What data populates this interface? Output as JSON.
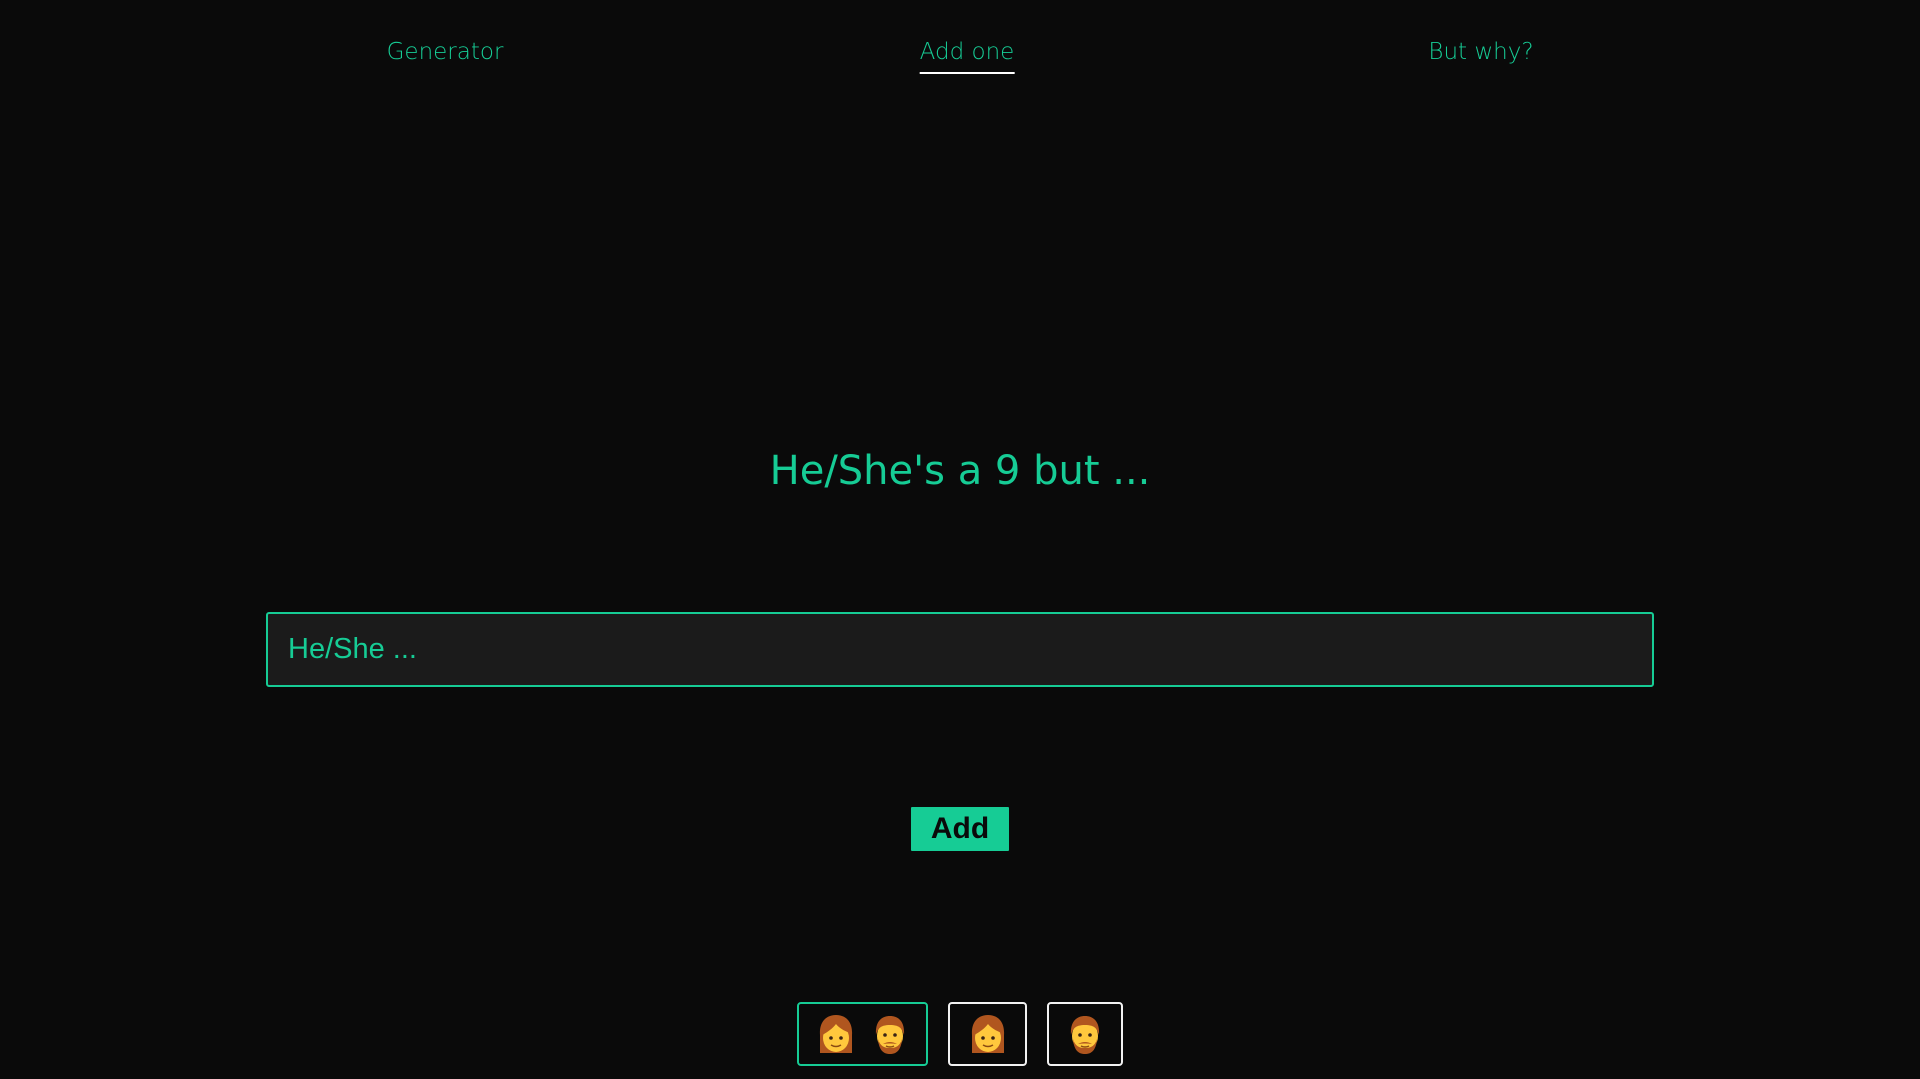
{
  "nav": {
    "items": [
      {
        "label": "Generator",
        "active": false
      },
      {
        "label": "Add one",
        "active": true
      },
      {
        "label": "But why?",
        "active": false
      }
    ]
  },
  "main": {
    "headline": "He/She's a 9 but ...",
    "input": {
      "placeholder": "He/She ...",
      "value": ""
    },
    "add_button_label": "Add"
  },
  "gender_selector": {
    "options": [
      {
        "icons": [
          "woman-icon",
          "man-icon"
        ],
        "selected": true
      },
      {
        "icons": [
          "woman-icon"
        ],
        "selected": false
      },
      {
        "icons": [
          "man-icon"
        ],
        "selected": false
      }
    ]
  },
  "colors": {
    "background": "#0a0a0a",
    "accent": "#16cc95",
    "input_background": "#1b1b1b",
    "active_underline": "#ffffff",
    "unselected_border": "#f2f2f2"
  }
}
